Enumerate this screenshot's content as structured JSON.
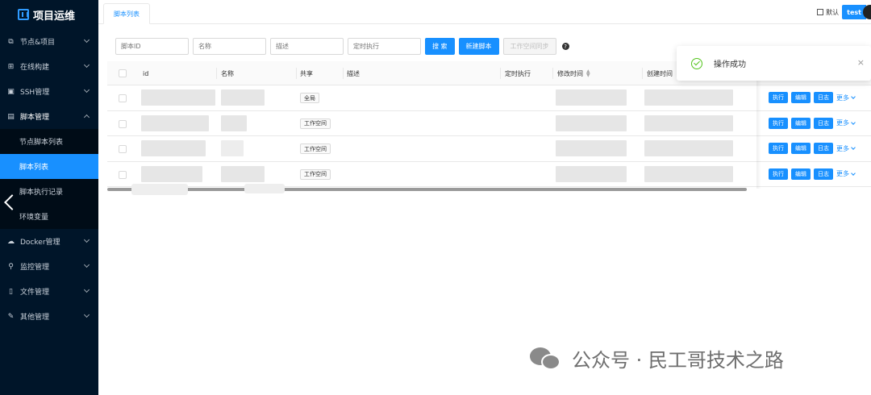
{
  "app": {
    "title": "项目运维"
  },
  "sidebar": {
    "items": [
      {
        "label": "节点&项目",
        "icon": "node-icon"
      },
      {
        "label": "在线构建",
        "icon": "build-icon"
      },
      {
        "label": "SSH管理",
        "icon": "terminal-icon"
      },
      {
        "label": "脚本管理",
        "icon": "script-icon"
      },
      {
        "label": "Docker管理",
        "icon": "docker-icon"
      },
      {
        "label": "监控管理",
        "icon": "monitor-icon"
      },
      {
        "label": "文件管理",
        "icon": "file-icon"
      },
      {
        "label": "其他管理",
        "icon": "wrench-icon"
      }
    ],
    "submenu": [
      "节点脚本列表",
      "脚本列表",
      "脚本执行记录",
      "环境变量"
    ]
  },
  "tabs": {
    "active": "脚本列表"
  },
  "header": {
    "workspace_label": "默认",
    "user": "test"
  },
  "filters": {
    "id_placeholder": "脚本ID",
    "name_placeholder": "名称",
    "desc_placeholder": "描述",
    "cron_placeholder": "定时执行",
    "search_label": "搜 索",
    "create_label": "新建脚本",
    "sync_label": "工作空间同步"
  },
  "table": {
    "columns": [
      "id",
      "名称",
      "共享",
      "描述",
      "定时执行",
      "修改时间",
      "创建时间"
    ],
    "rows": [
      {
        "share": "全局"
      },
      {
        "share": "工作空间"
      },
      {
        "share": "工作空间"
      },
      {
        "share": "工作空间"
      }
    ],
    "actions": {
      "run": "执行",
      "edit": "编辑",
      "log": "日志",
      "more": "更多"
    }
  },
  "notification": {
    "text": "操作成功",
    "close": "×"
  },
  "watermark": {
    "text": "公众号 · 民工哥技术之路"
  }
}
